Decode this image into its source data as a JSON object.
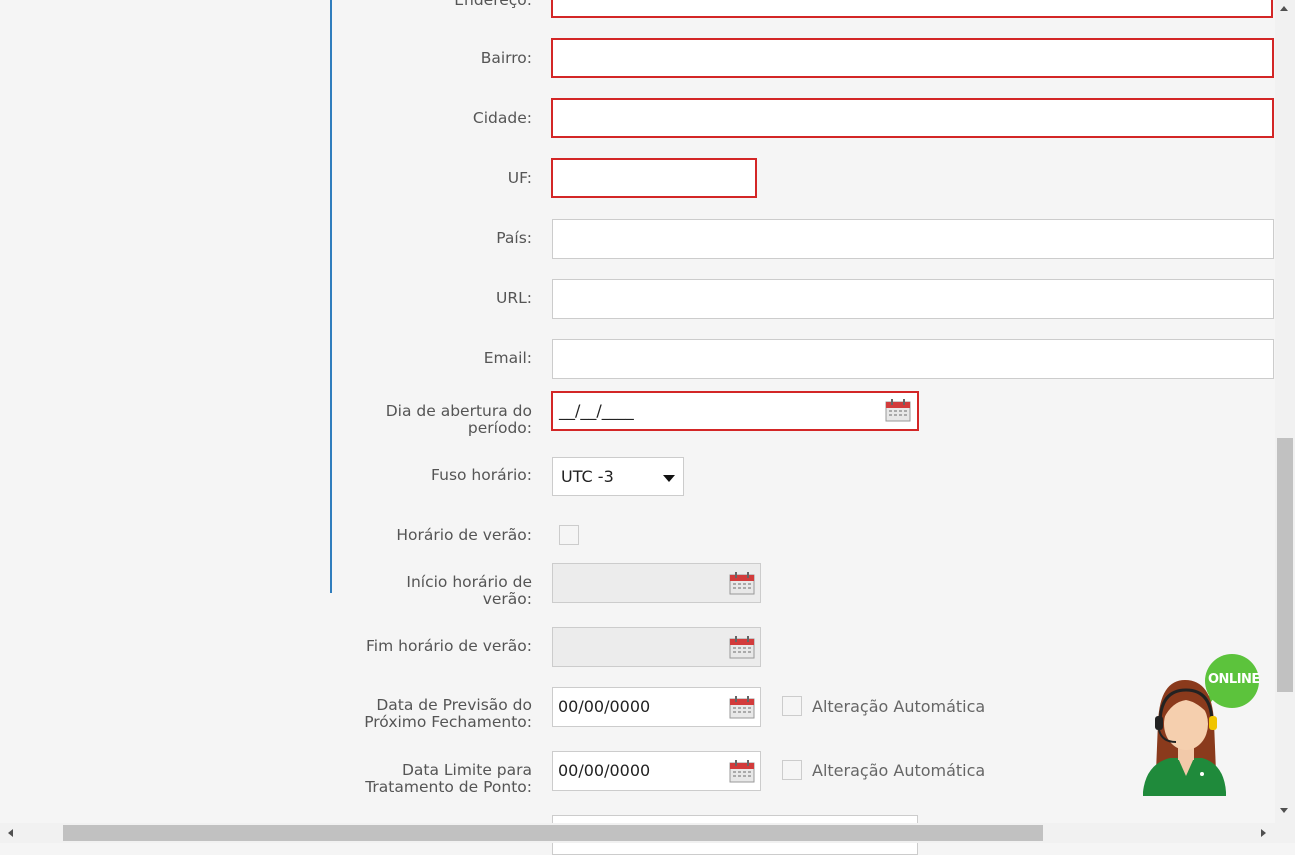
{
  "form": {
    "endereco_label": "Endereço:",
    "bairro_label": "Bairro:",
    "cidade_label": "Cidade:",
    "uf_label": "UF:",
    "pais_label": "País:",
    "url_label": "URL:",
    "email_label": "Email:",
    "abertura_label_1": "Dia de abertura do",
    "abertura_label_2": "período:",
    "abertura_value": "__/__/____",
    "fuso_label": "Fuso horário:",
    "fuso_value": "UTC -3",
    "horario_verao_label": "Horário de verão:",
    "inicio_verao_label_1": "Início horário de",
    "inicio_verao_label_2": "verão:",
    "fim_verao_label": "Fim horário de verão:",
    "previsao_label_1": "Data de Previsão do",
    "previsao_label_2": "Próximo Fechamento:",
    "previsao_value": "00/00/0000",
    "limite_label_1": "Data Limite para",
    "limite_label_2": "Tratamento de Ponto:",
    "limite_value": "00/00/0000",
    "alteracao_automatica_1": "Alteração Automática",
    "alteracao_automatica_2": "Alteração Automática"
  },
  "chat_widget": {
    "badge": "ONLINE",
    "badge_color": "#5cc33c",
    "uniform_color": "#1f8a3b"
  },
  "colors": {
    "required_border": "#d32626",
    "accent_line": "#2f7dbd"
  },
  "icons": [
    "calendar-icon",
    "dropdown-arrow-icon",
    "scroll-up-arrow-icon",
    "scroll-down-arrow-icon",
    "scroll-left-arrow-icon",
    "scroll-right-arrow-icon"
  ]
}
